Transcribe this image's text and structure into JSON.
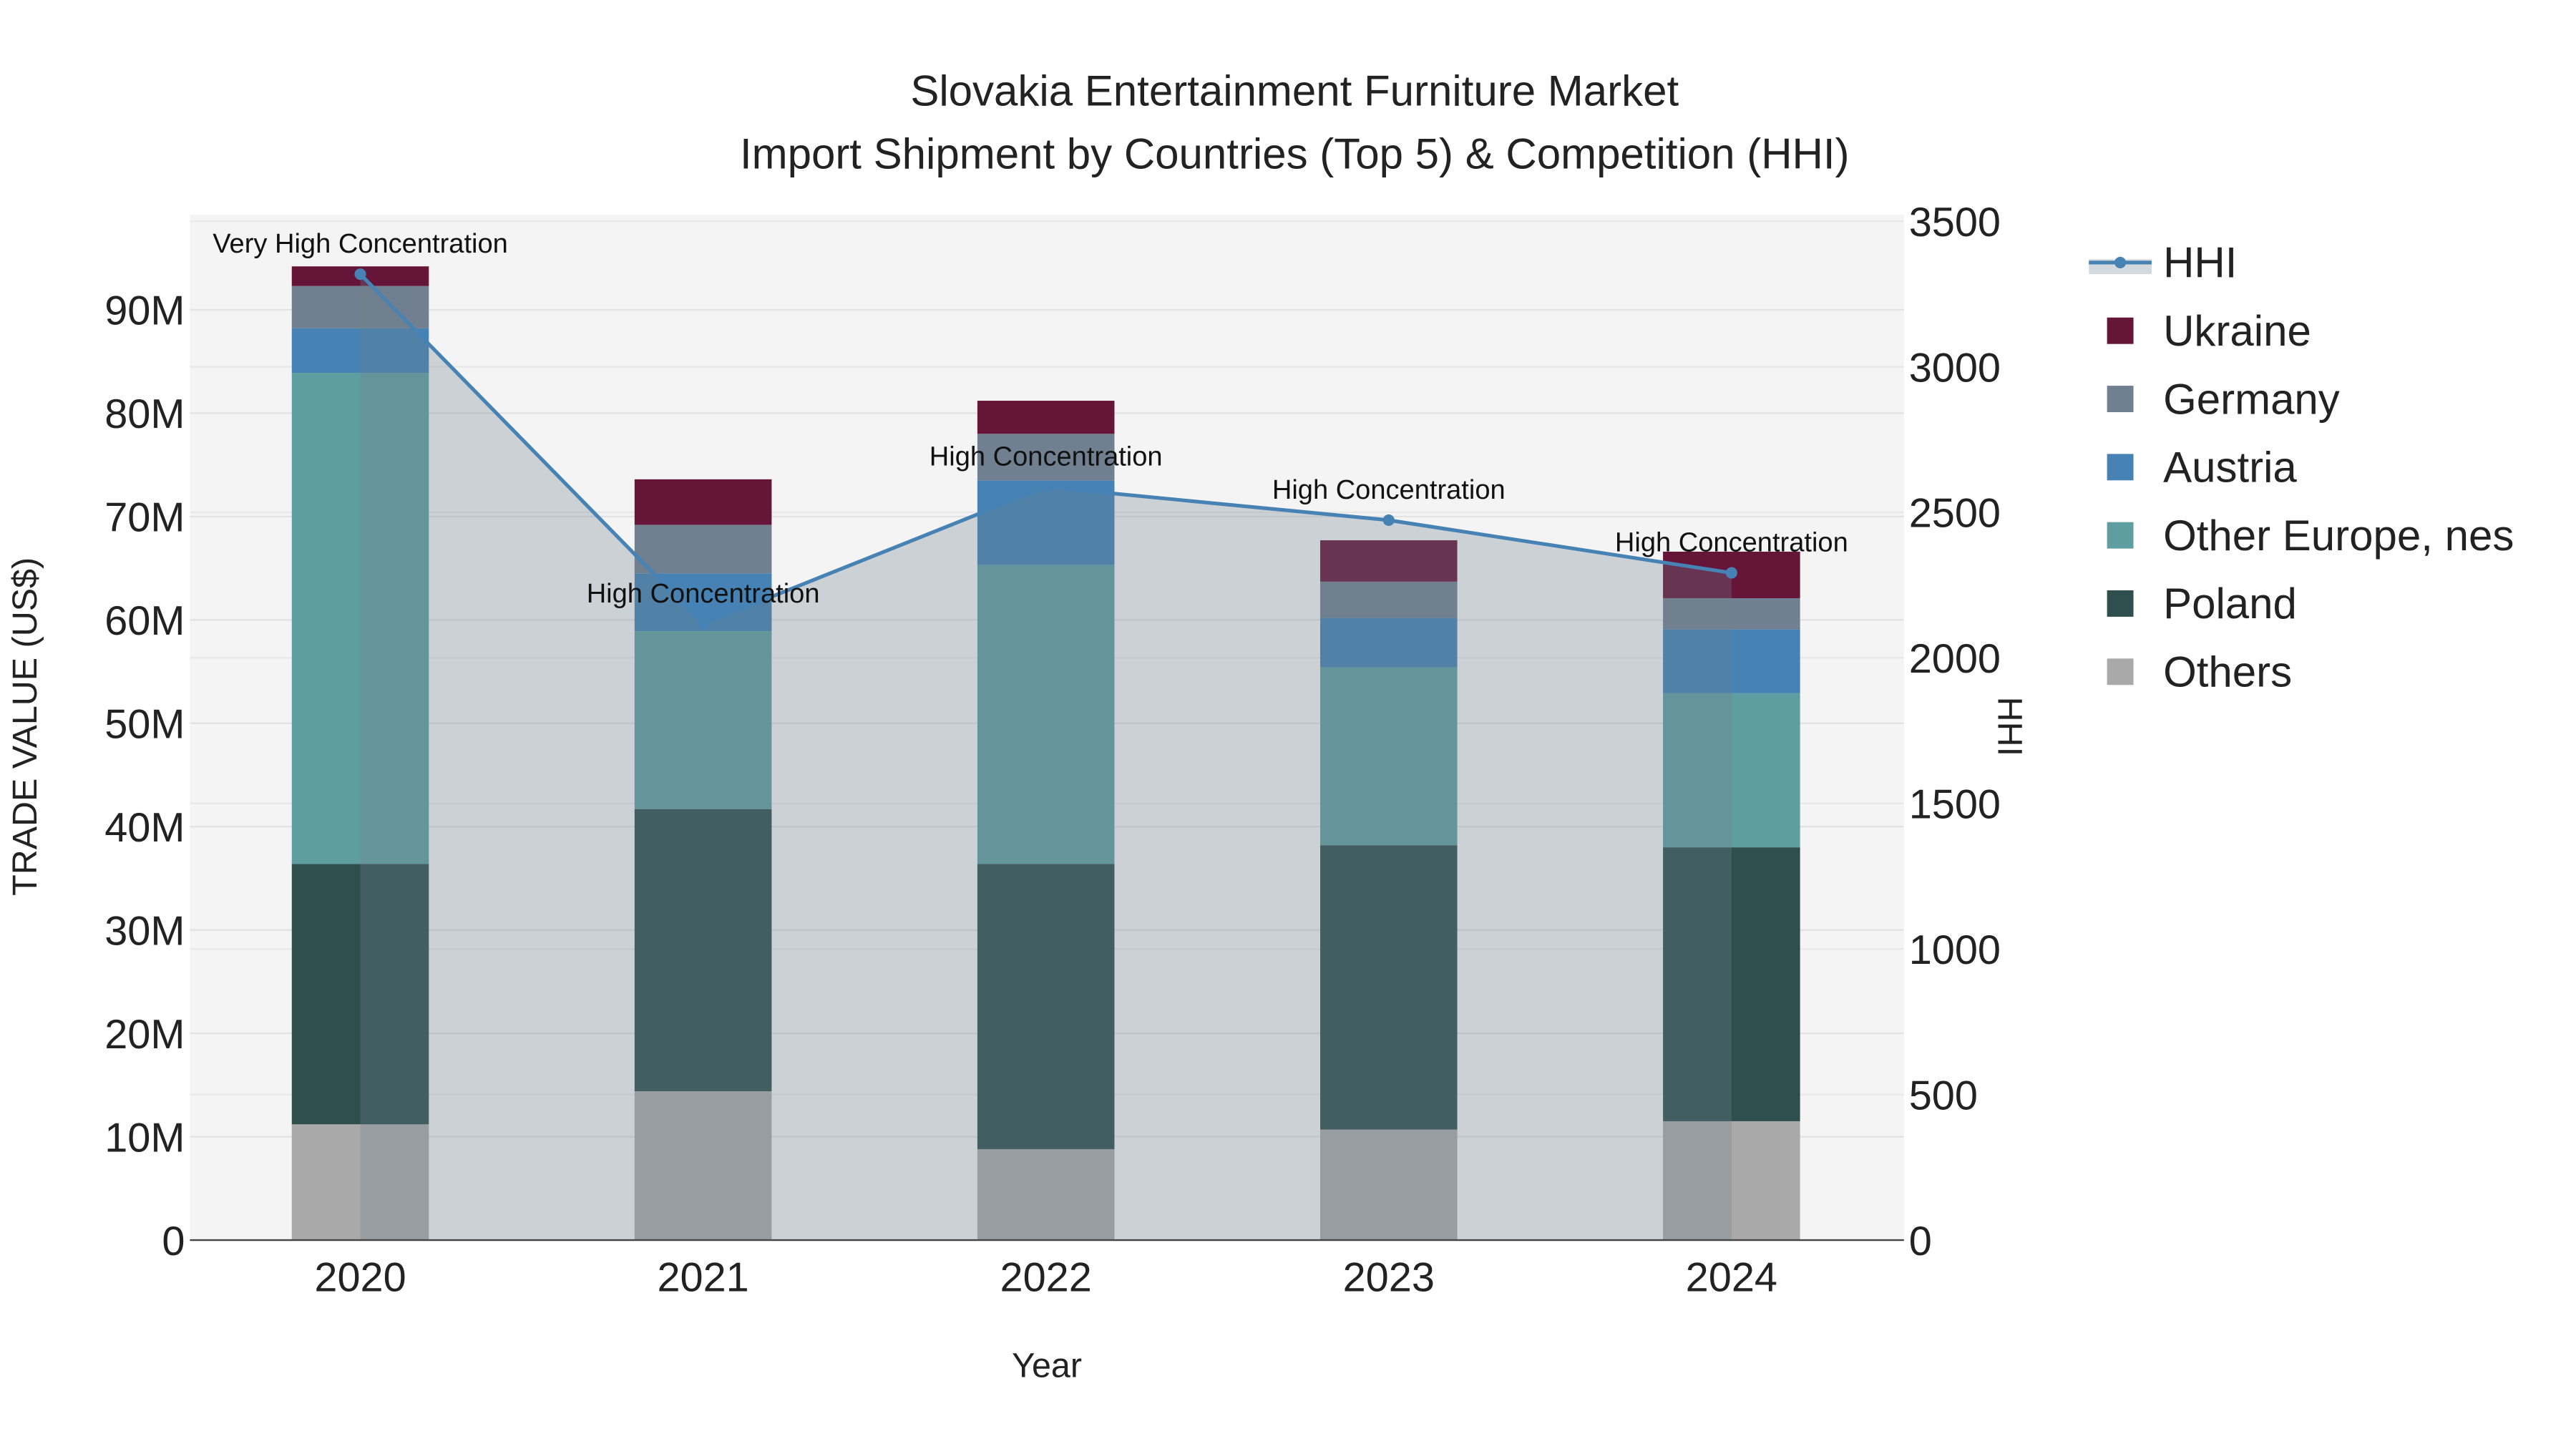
{
  "chart_data": {
    "type": "bar",
    "stacked": true,
    "title": "Slovakia Entertainment Furniture Market",
    "subtitle": "Import Shipment by Countries (Top 5) & Competition (HHI)",
    "xlabel": "Year",
    "ylabel": "TRADE VALUE (US$)",
    "y2label": "HHI",
    "categories": [
      "2020",
      "2021",
      "2022",
      "2023",
      "2024"
    ],
    "ylim": [
      0,
      97000000
    ],
    "y2lim": [
      0,
      3520
    ],
    "yticks": [
      0,
      10000000,
      20000000,
      30000000,
      40000000,
      50000000,
      60000000,
      70000000,
      80000000,
      90000000
    ],
    "ytick_labels": [
      "0",
      "10M",
      "20M",
      "30M",
      "40M",
      "50M",
      "60M",
      "70M",
      "80M",
      "90M"
    ],
    "y2ticks": [
      0,
      500,
      1000,
      1500,
      2000,
      2500,
      3000,
      3500
    ],
    "y2tick_labels": [
      "0",
      "500",
      "1000",
      "1500",
      "2000",
      "2500",
      "3000",
      "3500"
    ],
    "series": [
      {
        "name": "Others",
        "color": "#a9a9a9",
        "values": [
          11200000,
          14400000,
          8800000,
          10700000,
          11500000
        ]
      },
      {
        "name": "Poland",
        "color": "#2f4f4f",
        "values": [
          25200000,
          27300000,
          27600000,
          27500000,
          26500000
        ]
      },
      {
        "name": "Other Europe, nes",
        "color": "#5f9ea0",
        "values": [
          47500000,
          17200000,
          28900000,
          17200000,
          14900000
        ]
      },
      {
        "name": "Austria",
        "color": "#4682b4",
        "values": [
          4300000,
          5600000,
          8200000,
          4800000,
          6200000
        ]
      },
      {
        "name": "Germany",
        "color": "#708090",
        "values": [
          4100000,
          4700000,
          4500000,
          3500000,
          3000000
        ]
      },
      {
        "name": "Ukraine",
        "color": "#641538",
        "values": [
          1900000,
          4400000,
          3200000,
          4000000,
          4500000
        ]
      }
    ],
    "line": {
      "name": "HHI",
      "color": "#4682b4",
      "values": [
        3318,
        2116,
        2587,
        2473,
        2292
      ]
    },
    "annotations": [
      "Very High Concentration",
      "High Concentration",
      "High Concentration",
      "High Concentration",
      "High Concentration"
    ],
    "legend_order": [
      "HHI",
      "Ukraine",
      "Germany",
      "Austria",
      "Other Europe, nes",
      "Poland",
      "Others"
    ],
    "legend_position": "right",
    "grid": true
  }
}
